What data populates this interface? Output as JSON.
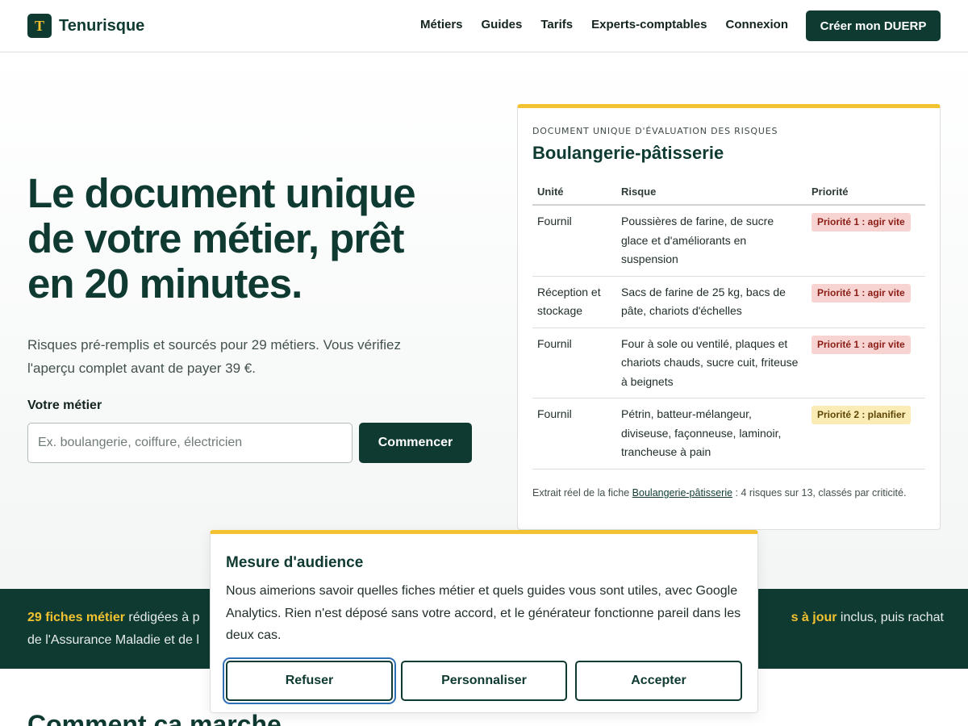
{
  "header": {
    "logo_mark": "T",
    "logo_text": "Tenurisque",
    "nav": [
      "Métiers",
      "Guides",
      "Tarifs",
      "Experts-comptables",
      "Connexion"
    ],
    "cta": "Créer mon DUERP"
  },
  "hero": {
    "title": "Le document unique de votre métier, prêt en 20 minutes.",
    "subtitle": "Risques pré-remplis et sourcés pour 29 métiers. Vous vérifiez l'aperçu complet avant de payer 39 €.",
    "field_label": "Votre métier",
    "input_placeholder": "Ex. boulangerie, coiffure, électricien",
    "input_value": "",
    "start_button": "Commencer"
  },
  "preview": {
    "eyebrow": "DOCUMENT UNIQUE D'ÉVALUATION DES RISQUES",
    "title": "Boulangerie-pâtisserie",
    "columns": [
      "Unité",
      "Risque",
      "Priorité"
    ],
    "rows": [
      {
        "unit": "Fournil",
        "risk": "Poussières de farine, de sucre glace et d'améliorants en suspension",
        "priority": "Priorité 1 : agir vite",
        "level": 1
      },
      {
        "unit": "Réception et stockage",
        "risk": "Sacs de farine de 25 kg, bacs de pâte, chariots d'échelles",
        "priority": "Priorité 1 : agir vite",
        "level": 1
      },
      {
        "unit": "Fournil",
        "risk": "Four à sole ou ventilé, plaques et chariots chauds, sucre cuit, friteuse à beignets",
        "priority": "Priorité 1 : agir vite",
        "level": 1
      },
      {
        "unit": "Fournil",
        "risk": "Pétrin, batteur-mélangeur, diviseuse, façonneuse, laminoir, trancheuse à pain",
        "priority": "Priorité 2 : planifier",
        "level": 2
      }
    ],
    "note_prefix": "Extrait réel de la fiche ",
    "note_link": "Boulangerie-pâtisserie",
    "note_suffix": " : 4 risques sur 13, classés par criticité."
  },
  "band": {
    "left_highlight": "29 fiches métier",
    "left_text": " rédigées à p",
    "left_line2": "de l'Assurance Maladie et de l",
    "right_highlight": "s à jour",
    "right_text": " inclus, puis rachat"
  },
  "section": {
    "title": "Comment ça marche"
  },
  "cookie": {
    "title": "Mesure d'audience",
    "text": "Nous aimerions savoir quelles fiches métier et quels guides vous sont utiles, avec Google Analytics. Rien n'est déposé sans votre accord, et le générateur fonctionne pareil dans les deux cas.",
    "refuse": "Refuser",
    "customize": "Personnaliser",
    "accept": "Accepter"
  },
  "colors": {
    "brand": "#0e3a32",
    "accent": "#f2c230",
    "priority1_bg": "#f7d4d1",
    "priority2_bg": "#fbecb5"
  }
}
